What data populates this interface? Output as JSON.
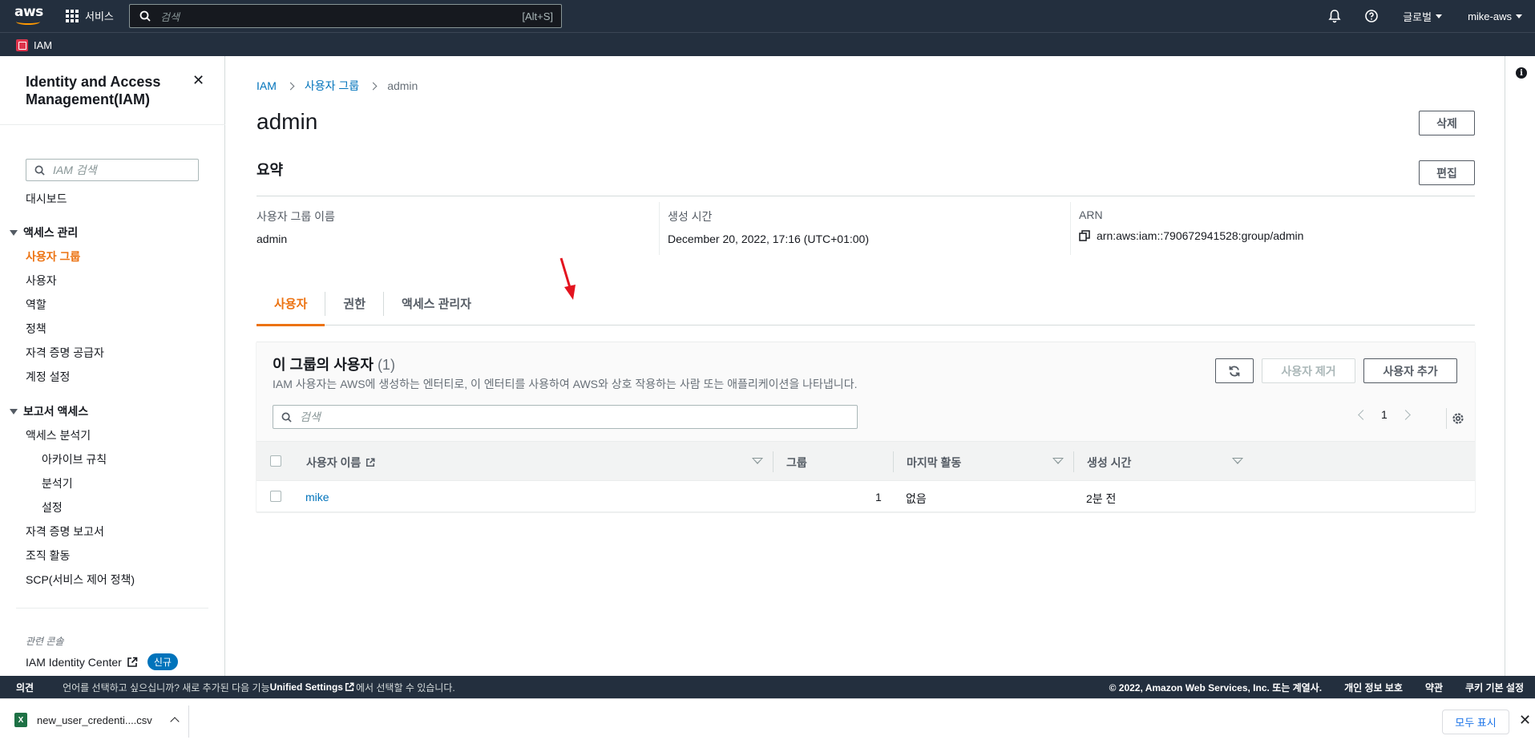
{
  "topnav": {
    "logo_text": "aws",
    "services_label": "서비스",
    "search_placeholder": "검색",
    "search_shortcut": "[Alt+S]",
    "region_label": "글로벌",
    "account_label": "mike-aws",
    "accent_color": "#ff9900"
  },
  "subnav": {
    "service_label": "IAM"
  },
  "sidebar": {
    "title": "Identity and Access Management(IAM)",
    "search_placeholder": "IAM 검색",
    "dashboard": "대시보드",
    "access_mgmt": {
      "label": "액세스 관리",
      "items": [
        "사용자 그룹",
        "사용자",
        "역할",
        "정책",
        "자격 증명 공급자",
        "계정 설정"
      ],
      "active_index": 0
    },
    "access_reports": {
      "label": "보고서 액세스",
      "analyzer": "액세스 분석기",
      "analyzer_children": [
        "아카이브 규칙",
        "분석기",
        "설정"
      ],
      "items": [
        "자격 증명 보고서",
        "조직 활동",
        "SCP(서비스 제어 정책)"
      ]
    },
    "related_consoles": "관련 콘솔",
    "identity_center": "IAM Identity Center",
    "new_badge": "신규"
  },
  "main": {
    "breadcrumb": [
      "IAM",
      "사용자 그룹",
      "admin"
    ],
    "title": "admin",
    "delete_button": "삭제",
    "summary": {
      "heading": "요약",
      "edit_button": "편집",
      "group_name_label": "사용자 그룹 이름",
      "group_name_value": "admin",
      "created_label": "생성 시간",
      "created_value": "December 20, 2022, 17:16 (UTC+01:00)",
      "arn_label": "ARN",
      "arn_value": "arn:aws:iam::790672941528:group/admin"
    },
    "tabs": [
      "사용자",
      "권한",
      "액세스 관리자"
    ],
    "active_tab": 0,
    "users_panel": {
      "title": "이 그룹의 사용자",
      "count": "(1)",
      "description": "IAM 사용자는 AWS에 생성하는 엔터티로, 이 엔터티를 사용하여 AWS와 상호 작용하는 사람 또는 애플리케이션을 나타냅니다.",
      "remove_button": "사용자 제거",
      "add_button": "사용자 추가",
      "search_placeholder": "검색",
      "page": "1",
      "columns": [
        "사용자 이름",
        "그룹",
        "마지막 활동",
        "생성 시간"
      ],
      "rows": [
        {
          "name": "mike",
          "groups": "1",
          "last_activity": "없음",
          "created": "2분 전"
        }
      ]
    }
  },
  "footer": {
    "feedback": "의견",
    "lang_prefix": "언어를 선택하고 싶으십니까? 새로 추가된 다음 기능",
    "lang_link": "Unified Settings",
    "lang_suffix": "에서 선택할 수 있습니다.",
    "copyright": "© 2022, Amazon Web Services, Inc. 또는 계열사.",
    "privacy": "개인 정보 보호",
    "terms": "약관",
    "cookies": "쿠키 기본 설정"
  },
  "downloads": {
    "file_name": "new_user_credenti....csv",
    "show_all": "모두 표시"
  }
}
